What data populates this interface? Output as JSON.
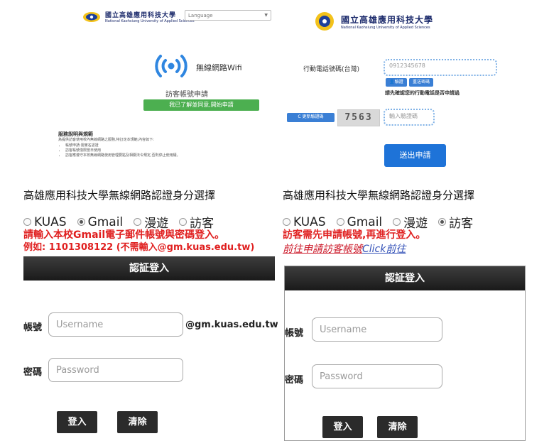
{
  "guest_page": {
    "logo": {
      "name_cn": "國立高雄應用科技大學",
      "name_en": "National Kaohsiung University of Applied Sciences"
    },
    "language_select": {
      "value": "Language"
    },
    "wifi_title": "無線網路Wifi",
    "apply_title": "訪客帳號申請",
    "agree_button": "我已了解並同意,開始申請",
    "service_title": "服務說明與規範",
    "service_text": "為提供訪客使用校內無線網路之服務,特訂定本規範,內容如下:",
    "service_items": [
      "帳號申請:需實名認證",
      "訪客帳號僅限當日使用",
      "訪客應遵守本校無線網路使用管理要點及相關法令規定,否則停止使用權。"
    ]
  },
  "apply_page": {
    "logo": {
      "name_cn": "國立高雄應用科技大學",
      "name_en": "National Kaohsiung University of Applied Sciences"
    },
    "phone_label": "行動電話號碼(台灣)",
    "phone_value": "0912345678",
    "verify_button": "驗證",
    "resend_button": "重送密碼",
    "hint": "請先確認您的行動電話是否申請過",
    "refresh_captcha_button": "更新驗證碼",
    "captcha_text": "7563",
    "captcha_placeholder": "輸入驗證碼",
    "submit_button": "送出申請"
  },
  "login_left": {
    "title": "高雄應用科技大學無線網路認證身分選擇",
    "options": [
      "KUAS",
      "Gmail",
      "漫遊",
      "訪客"
    ],
    "selected_index": 1,
    "note_line1": "請輸入本校Gmail電子郵件帳號與密碼登入。",
    "note_line2": "例如: 1101308122 (不需輸入@gm.kuas.edu.tw)",
    "panel_title": "認証登入",
    "username_label": "帳號",
    "username_placeholder": "Username",
    "username_suffix": "@gm.kuas.edu.tw",
    "password_label": "密碼",
    "password_placeholder": "Password",
    "login_button": "登入",
    "clear_button": "清除"
  },
  "login_right": {
    "title": "高雄應用科技大學無線網路認證身分選擇",
    "options": [
      "KUAS",
      "Gmail",
      "漫遊",
      "訪客"
    ],
    "selected_index": 3,
    "note_line1": "訪客需先申請帳號,再進行登入。",
    "link_part1": "前往申請訪客帳號",
    "link_part2": "Click前往",
    "panel_title": "認証登入",
    "username_label": "帳號",
    "username_placeholder": "Username",
    "password_label": "密碼",
    "password_placeholder": "Password",
    "login_button": "登入",
    "clear_button": "清除"
  },
  "colors": {
    "note_red": "#e02020",
    "link_blue": "#3452b8",
    "header_dark": "#2a2a2a",
    "green": "#4caf50",
    "submit_blue": "#1e73d8"
  }
}
